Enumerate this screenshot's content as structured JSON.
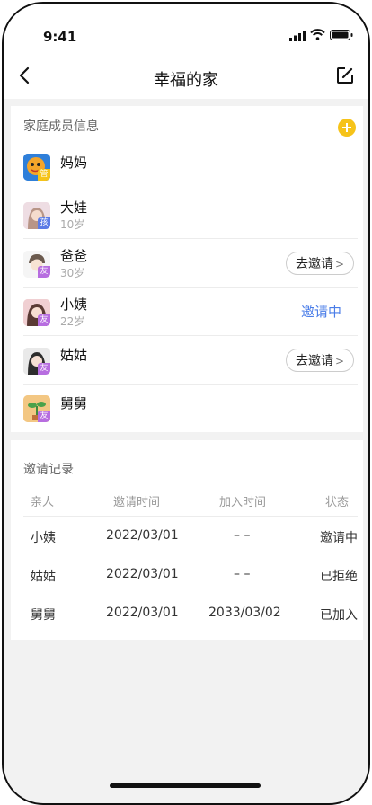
{
  "status_bar": {
    "time": "9:41"
  },
  "nav": {
    "title": "幸福的家"
  },
  "members_section": {
    "title": "家庭成员信息",
    "members": [
      {
        "name": "妈妈",
        "age": "",
        "tag": "管",
        "tag_color": "#f6c319",
        "action": "none"
      },
      {
        "name": "大娃",
        "age": "10岁",
        "tag": "孩",
        "tag_color": "#5b7be6",
        "action": "none"
      },
      {
        "name": "爸爸",
        "age": "30岁",
        "tag": "友",
        "tag_color": "#b76de0",
        "action": "invite",
        "action_label": "去邀请"
      },
      {
        "name": "小姨",
        "age": "22岁",
        "tag": "友",
        "tag_color": "#b76de0",
        "action": "inviting",
        "action_label": "邀请中"
      },
      {
        "name": "姑姑",
        "age": "",
        "tag": "友",
        "tag_color": "#b76de0",
        "action": "invite",
        "action_label": "去邀请"
      },
      {
        "name": "舅舅",
        "age": "",
        "tag": "友",
        "tag_color": "#b76de0",
        "action": "none"
      }
    ]
  },
  "records_section": {
    "title": "邀请记录",
    "columns": [
      "亲人",
      "邀请时间",
      "加入时间",
      "状态"
    ],
    "rows": [
      [
        "小姨",
        "2022/03/01",
        "– –",
        "邀请中"
      ],
      [
        "姑姑",
        "2022/03/01",
        "– –",
        "已拒绝"
      ],
      [
        "舅舅",
        "2022/03/01",
        "2033/03/02",
        "已加入"
      ]
    ]
  },
  "colors": {
    "accent_yellow": "#f6c319",
    "link_blue": "#4a7de8",
    "page_bg": "#f2f2f2"
  }
}
